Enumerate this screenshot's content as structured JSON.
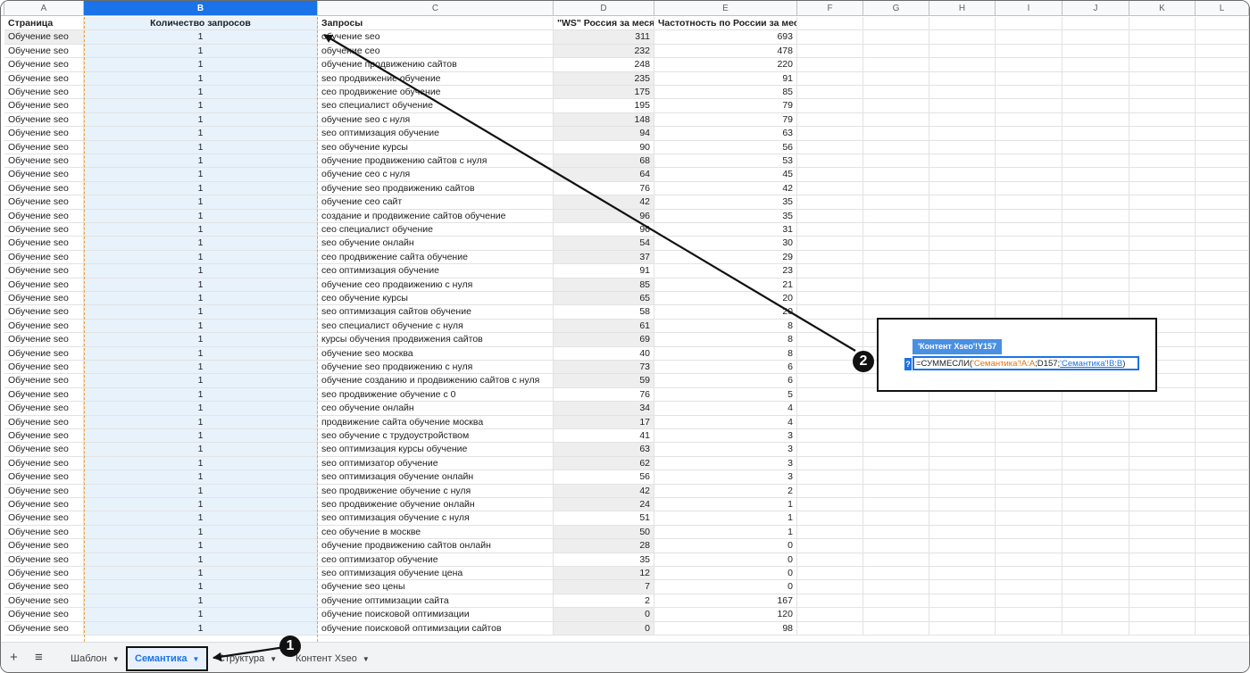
{
  "columns": [
    "A",
    "B",
    "C",
    "D",
    "E",
    "F",
    "G",
    "H",
    "I",
    "J",
    "K",
    "L"
  ],
  "header": {
    "a": "Страница",
    "b": "Количество запросов",
    "c": "Запросы",
    "d": "\"WS\" Россия за месяц",
    "e": "Частотность по России за месяц"
  },
  "rows": [
    {
      "page": "Обучение seo",
      "count": "1",
      "query": "обучение seo",
      "ws": "311",
      "freq": "693"
    },
    {
      "page": "Обучение seo",
      "count": "1",
      "query": "обучение сео",
      "ws": "232",
      "freq": "478"
    },
    {
      "page": "Обучение seo",
      "count": "1",
      "query": "обучение продвижению сайтов",
      "ws": "248",
      "freq": "220"
    },
    {
      "page": "Обучение seo",
      "count": "1",
      "query": "seo продвижение обучение",
      "ws": "235",
      "freq": "91"
    },
    {
      "page": "Обучение seo",
      "count": "1",
      "query": "сео продвижение обучение",
      "ws": "175",
      "freq": "85"
    },
    {
      "page": "Обучение seo",
      "count": "1",
      "query": "seo специалист обучение",
      "ws": "195",
      "freq": "79"
    },
    {
      "page": "Обучение seo",
      "count": "1",
      "query": "обучение seo с нуля",
      "ws": "148",
      "freq": "79"
    },
    {
      "page": "Обучение seo",
      "count": "1",
      "query": "seo оптимизация обучение",
      "ws": "94",
      "freq": "63"
    },
    {
      "page": "Обучение seo",
      "count": "1",
      "query": "seo обучение курсы",
      "ws": "90",
      "freq": "56"
    },
    {
      "page": "Обучение seo",
      "count": "1",
      "query": "обучение продвижению сайтов с нуля",
      "ws": "68",
      "freq": "53"
    },
    {
      "page": "Обучение seo",
      "count": "1",
      "query": "обучение сео с нуля",
      "ws": "64",
      "freq": "45"
    },
    {
      "page": "Обучение seo",
      "count": "1",
      "query": "обучение seo продвижению сайтов",
      "ws": "76",
      "freq": "42"
    },
    {
      "page": "Обучение seo",
      "count": "1",
      "query": "обучение сео сайт",
      "ws": "42",
      "freq": "35"
    },
    {
      "page": "Обучение seo",
      "count": "1",
      "query": "создание и продвижение сайтов обучение",
      "ws": "96",
      "freq": "35"
    },
    {
      "page": "Обучение seo",
      "count": "1",
      "query": "сео специалист обучение",
      "ws": "96",
      "freq": "31"
    },
    {
      "page": "Обучение seo",
      "count": "1",
      "query": "seo обучение онлайн",
      "ws": "54",
      "freq": "30"
    },
    {
      "page": "Обучение seo",
      "count": "1",
      "query": "сео продвижение сайта обучение",
      "ws": "37",
      "freq": "29"
    },
    {
      "page": "Обучение seo",
      "count": "1",
      "query": "сео оптимизация обучение",
      "ws": "91",
      "freq": "23"
    },
    {
      "page": "Обучение seo",
      "count": "1",
      "query": "обучение сео продвижению с нуля",
      "ws": "85",
      "freq": "21"
    },
    {
      "page": "Обучение seo",
      "count": "1",
      "query": "сео обучение курсы",
      "ws": "65",
      "freq": "20"
    },
    {
      "page": "Обучение seo",
      "count": "1",
      "query": "seo оптимизация сайтов обучение",
      "ws": "58",
      "freq": "20"
    },
    {
      "page": "Обучение seo",
      "count": "1",
      "query": "seo специалист обучение с нуля",
      "ws": "61",
      "freq": "8"
    },
    {
      "page": "Обучение seo",
      "count": "1",
      "query": "курсы обучения продвижения сайтов",
      "ws": "69",
      "freq": "8"
    },
    {
      "page": "Обучение seo",
      "count": "1",
      "query": "обучение seo москва",
      "ws": "40",
      "freq": "8"
    },
    {
      "page": "Обучение seo",
      "count": "1",
      "query": "обучение seo продвижению с нуля",
      "ws": "73",
      "freq": "6"
    },
    {
      "page": "Обучение seo",
      "count": "1",
      "query": "обучение созданию и продвижению сайтов с нуля",
      "ws": "59",
      "freq": "6"
    },
    {
      "page": "Обучение seo",
      "count": "1",
      "query": "seo продвижение обучение с 0",
      "ws": "76",
      "freq": "5"
    },
    {
      "page": "Обучение seo",
      "count": "1",
      "query": "сео обучение онлайн",
      "ws": "34",
      "freq": "4"
    },
    {
      "page": "Обучение seo",
      "count": "1",
      "query": "продвижение сайта обучение москва",
      "ws": "17",
      "freq": "4"
    },
    {
      "page": "Обучение seo",
      "count": "1",
      "query": "seo обучение с трудоустройством",
      "ws": "41",
      "freq": "3"
    },
    {
      "page": "Обучение seo",
      "count": "1",
      "query": "seo оптимизация курсы обучение",
      "ws": "63",
      "freq": "3"
    },
    {
      "page": "Обучение seo",
      "count": "1",
      "query": "seo оптимизатор обучение",
      "ws": "62",
      "freq": "3"
    },
    {
      "page": "Обучение seo",
      "count": "1",
      "query": "seo оптимизация обучение онлайн",
      "ws": "56",
      "freq": "3"
    },
    {
      "page": "Обучение seo",
      "count": "1",
      "query": "seo продвижение обучение с нуля",
      "ws": "42",
      "freq": "2"
    },
    {
      "page": "Обучение seo",
      "count": "1",
      "query": "seo продвижение обучение онлайн",
      "ws": "24",
      "freq": "1"
    },
    {
      "page": "Обучение seo",
      "count": "1",
      "query": "seo оптимизация обучение с нуля",
      "ws": "51",
      "freq": "1"
    },
    {
      "page": "Обучение seo",
      "count": "1",
      "query": "сео обучение в москве",
      "ws": "50",
      "freq": "1"
    },
    {
      "page": "Обучение seo",
      "count": "1",
      "query": "обучение продвижению сайтов онлайн",
      "ws": "28",
      "freq": "0"
    },
    {
      "page": "Обучение seo",
      "count": "1",
      "query": "сео оптимизатор обучение",
      "ws": "35",
      "freq": "0"
    },
    {
      "page": "Обучение seo",
      "count": "1",
      "query": "seo оптимизация обучение цена",
      "ws": "12",
      "freq": "0"
    },
    {
      "page": "Обучение seo",
      "count": "1",
      "query": "обучение seo цены",
      "ws": "7",
      "freq": "0"
    },
    {
      "page": "Обучение seo",
      "count": "1",
      "query": "обучение оптимизации сайта",
      "ws": "2",
      "freq": "167"
    },
    {
      "page": "Обучение seo",
      "count": "1",
      "query": "обучение поисковой оптимизации",
      "ws": "0",
      "freq": "120"
    },
    {
      "page": "Обучение seo",
      "count": "1",
      "query": "обучение поисковой оптимизации сайтов",
      "ws": "0",
      "freq": "98"
    }
  ],
  "tabs": {
    "add_icon": "+",
    "menu_icon": "≡",
    "items": [
      {
        "label": "Шаблон"
      },
      {
        "label": "Семантика"
      },
      {
        "label": "Структура"
      },
      {
        "label": "Контент Xseo"
      }
    ]
  },
  "formula": {
    "cell_ref": "'Контент Xseo'!Y157",
    "help": "?",
    "prefix": "=СУММЕСЛИ(",
    "ref1": "'Семантика'!A:A",
    "mid": ";D157;",
    "ref2": "'Семантика'!B:B",
    "suffix": ")"
  },
  "badges": {
    "one": "1",
    "two": "2"
  },
  "colors": {
    "accent": "#1a73e8",
    "selected_col_bg": "#e8f2fb",
    "arrow": "#111111"
  }
}
